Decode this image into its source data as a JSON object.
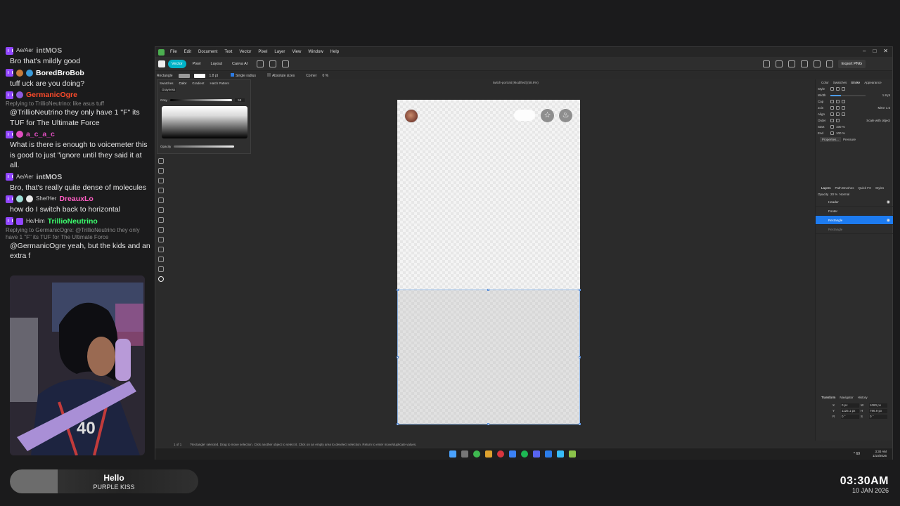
{
  "chat": {
    "messages": [
      {
        "pronouns": "Ae/Aer",
        "user": "intMOS",
        "color": "#a9a9a9",
        "text": "Bro that's mildly good"
      },
      {
        "pronouns": "",
        "user": "BoredBroBob",
        "color": "#ffffff",
        "text": "tuff uck are you doing?"
      },
      {
        "pronouns": "",
        "user": "GermanicOgre",
        "color": "#ff4b2b",
        "text": "@TrillioNeutrino they only have 1 \"F\" its TUF for The Ultimate Force",
        "reply": "Replying to TrillioNeutrino: like asus tuff"
      },
      {
        "pronouns": "",
        "user": "a_c_a_c",
        "color": "#e04ec0",
        "text": "What is there is enough to voicemeter this is good to just \"ignore until they said it at all."
      },
      {
        "pronouns": "Ae/Aer",
        "user": "intMOS",
        "color": "#c8c8c8",
        "text": "Bro, that's really quite dense of molecules"
      },
      {
        "pronouns": "She/Her",
        "user": "DreauxLo",
        "color": "#ff5ec4",
        "text": "how do I switch back to horizontal"
      },
      {
        "pronouns": "He/Him",
        "user": "TrillioNeutrino",
        "color": "#3cff6e",
        "text": "@GermanicOgre yeah, but the kids and an extra f",
        "reply": "Replying to GermanicOgre: @TrillioNeutrino they only have 1 \"F\" its TUF for The Ultimate Force"
      }
    ]
  },
  "now_playing": {
    "title": "Hello",
    "artist": "PURPLE KISS"
  },
  "clock": {
    "time": "03:30AM",
    "date": "10 JAN 2026"
  },
  "app": {
    "menus": [
      "File",
      "Edit",
      "Document",
      "Text",
      "Vector",
      "Pixel",
      "Layer",
      "View",
      "Window",
      "Help"
    ],
    "personas": [
      "Vector",
      "Pixel",
      "Layout",
      "Canva AI"
    ],
    "export_label": "Export PNG",
    "context": {
      "tool": "Rectangle",
      "stroke_width": "1.8 pt",
      "single_radius": "Single radius",
      "absolute_sizes": "Absolute sizes",
      "corner_label": "Corner",
      "corner_value": "0 %"
    },
    "doc_tab": "twitch-portrait [Modified] (58.8%)",
    "color_panel": {
      "tabs": [
        "Swatches",
        "Color",
        "Gradient",
        "Hatch Pattern"
      ],
      "mode": "Grayness",
      "gray_label": "Gray",
      "gray_value": "58",
      "opacity_label": "Opacity"
    },
    "status": {
      "page": "1 of 1",
      "message": "'Rectangle' selected. Drag to move selection. Click another object to select it. Click on an empty area to deselect selection. Return to enter move/duplicate values."
    },
    "right_panel": {
      "tabs": [
        "Color",
        "Swatches",
        "Stroke",
        "Appearance"
      ],
      "style_label": "Style",
      "width_label": "Width",
      "width_value": "1.8 pt",
      "width_fraction": 0.3,
      "cap_label": "Cap",
      "join_label": "Join",
      "mitre_label": "Mitre",
      "mitre_value": "1.5",
      "align_label": "Align",
      "order_label": "Order",
      "scale_label": "Scale with object",
      "start_label": "Start",
      "end_label": "End",
      "start_pct": "100 %",
      "end_pct": "100 %",
      "properties_label": "Properties...",
      "pressure_label": "Pressure",
      "layer_tabs": [
        "Layers",
        "Path Brushes",
        "Quick FX",
        "Styles"
      ],
      "opacity_label": "Opacity",
      "opacity_value": "20 %",
      "blend_mode": "Normal",
      "layers": [
        "Header",
        "Footer",
        "Rectangle",
        "Rectangle"
      ],
      "transform_tabs": [
        "Transform",
        "Navigator",
        "History"
      ],
      "transform": {
        "x": "0 px",
        "y": "1125.1 px",
        "w": "1080 px",
        "h": "796.9 px",
        "r": "0 °",
        "s": "0 °"
      }
    },
    "taskbar": {
      "time": "3:30 AM",
      "date": "1/10/2026",
      "volume": "69"
    }
  }
}
